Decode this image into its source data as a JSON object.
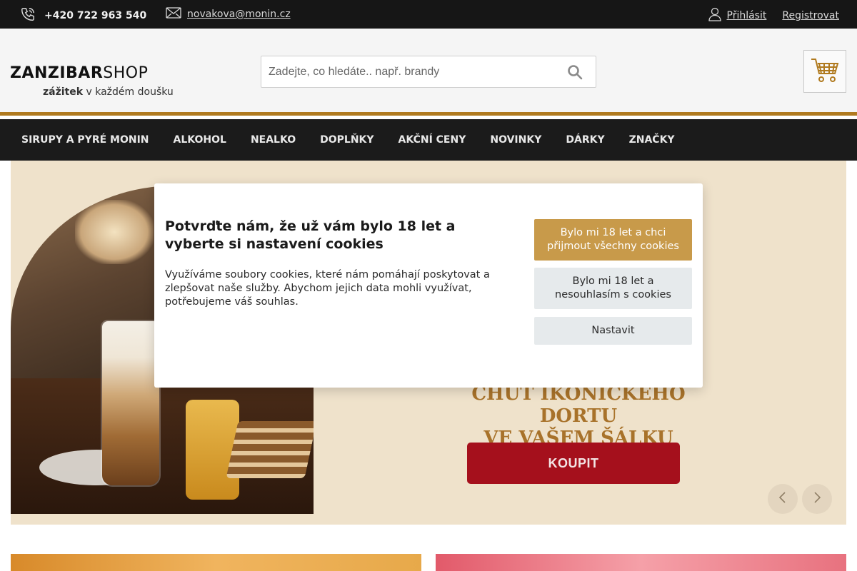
{
  "topbar": {
    "phone": "+420 722 963 540",
    "email": "novakova@monin.cz",
    "login_label": "Přihlásit",
    "register_label": "Registrovat"
  },
  "header": {
    "logo_bold": "ZANZIBAR",
    "logo_light": "SHOP",
    "tagline_bold": "zážitek",
    "tagline_rest": "v každém doušku",
    "search_placeholder": "Zadejte, co hledáte.. např. brandy"
  },
  "nav": {
    "items": [
      {
        "label": "SIRUPY A PYRÉ MONIN"
      },
      {
        "label": "ALKOHOL"
      },
      {
        "label": "NEALKO"
      },
      {
        "label": "DOPLŇKY"
      },
      {
        "label": "AKČNÍ CENY"
      },
      {
        "label": "NOVINKY"
      },
      {
        "label": "DÁRKY"
      },
      {
        "label": "ZNAČKY"
      }
    ]
  },
  "hero": {
    "headline_line1": "CHUŤ IKONICKÉHO DORTU",
    "headline_line2": "VE VAŠEM ŠÁLKU",
    "buy_label": "KOUPIT"
  },
  "cookie_modal": {
    "title": "Potvrďte nám, že už vám bylo 18 let a vyberte si nastavení cookies",
    "body": "Využíváme soubory cookies, které nám pomáhají poskytovat a zlepšovat naše služby. Abychom jejich data mohli využívat, potřebujeme váš souhlas.",
    "accept_label": "Bylo mi 18 let a chci přijmout všechny cookies",
    "necessary_label": "Bylo mi 18 let a nesouhlasím s cookies",
    "settings_label": "Nastavit"
  },
  "colors": {
    "accent": "#b07a1f",
    "accept_button": "#c89a4a",
    "buy_button": "#a5101c",
    "topbar": "#161616",
    "nav": "#1b1b1b"
  }
}
